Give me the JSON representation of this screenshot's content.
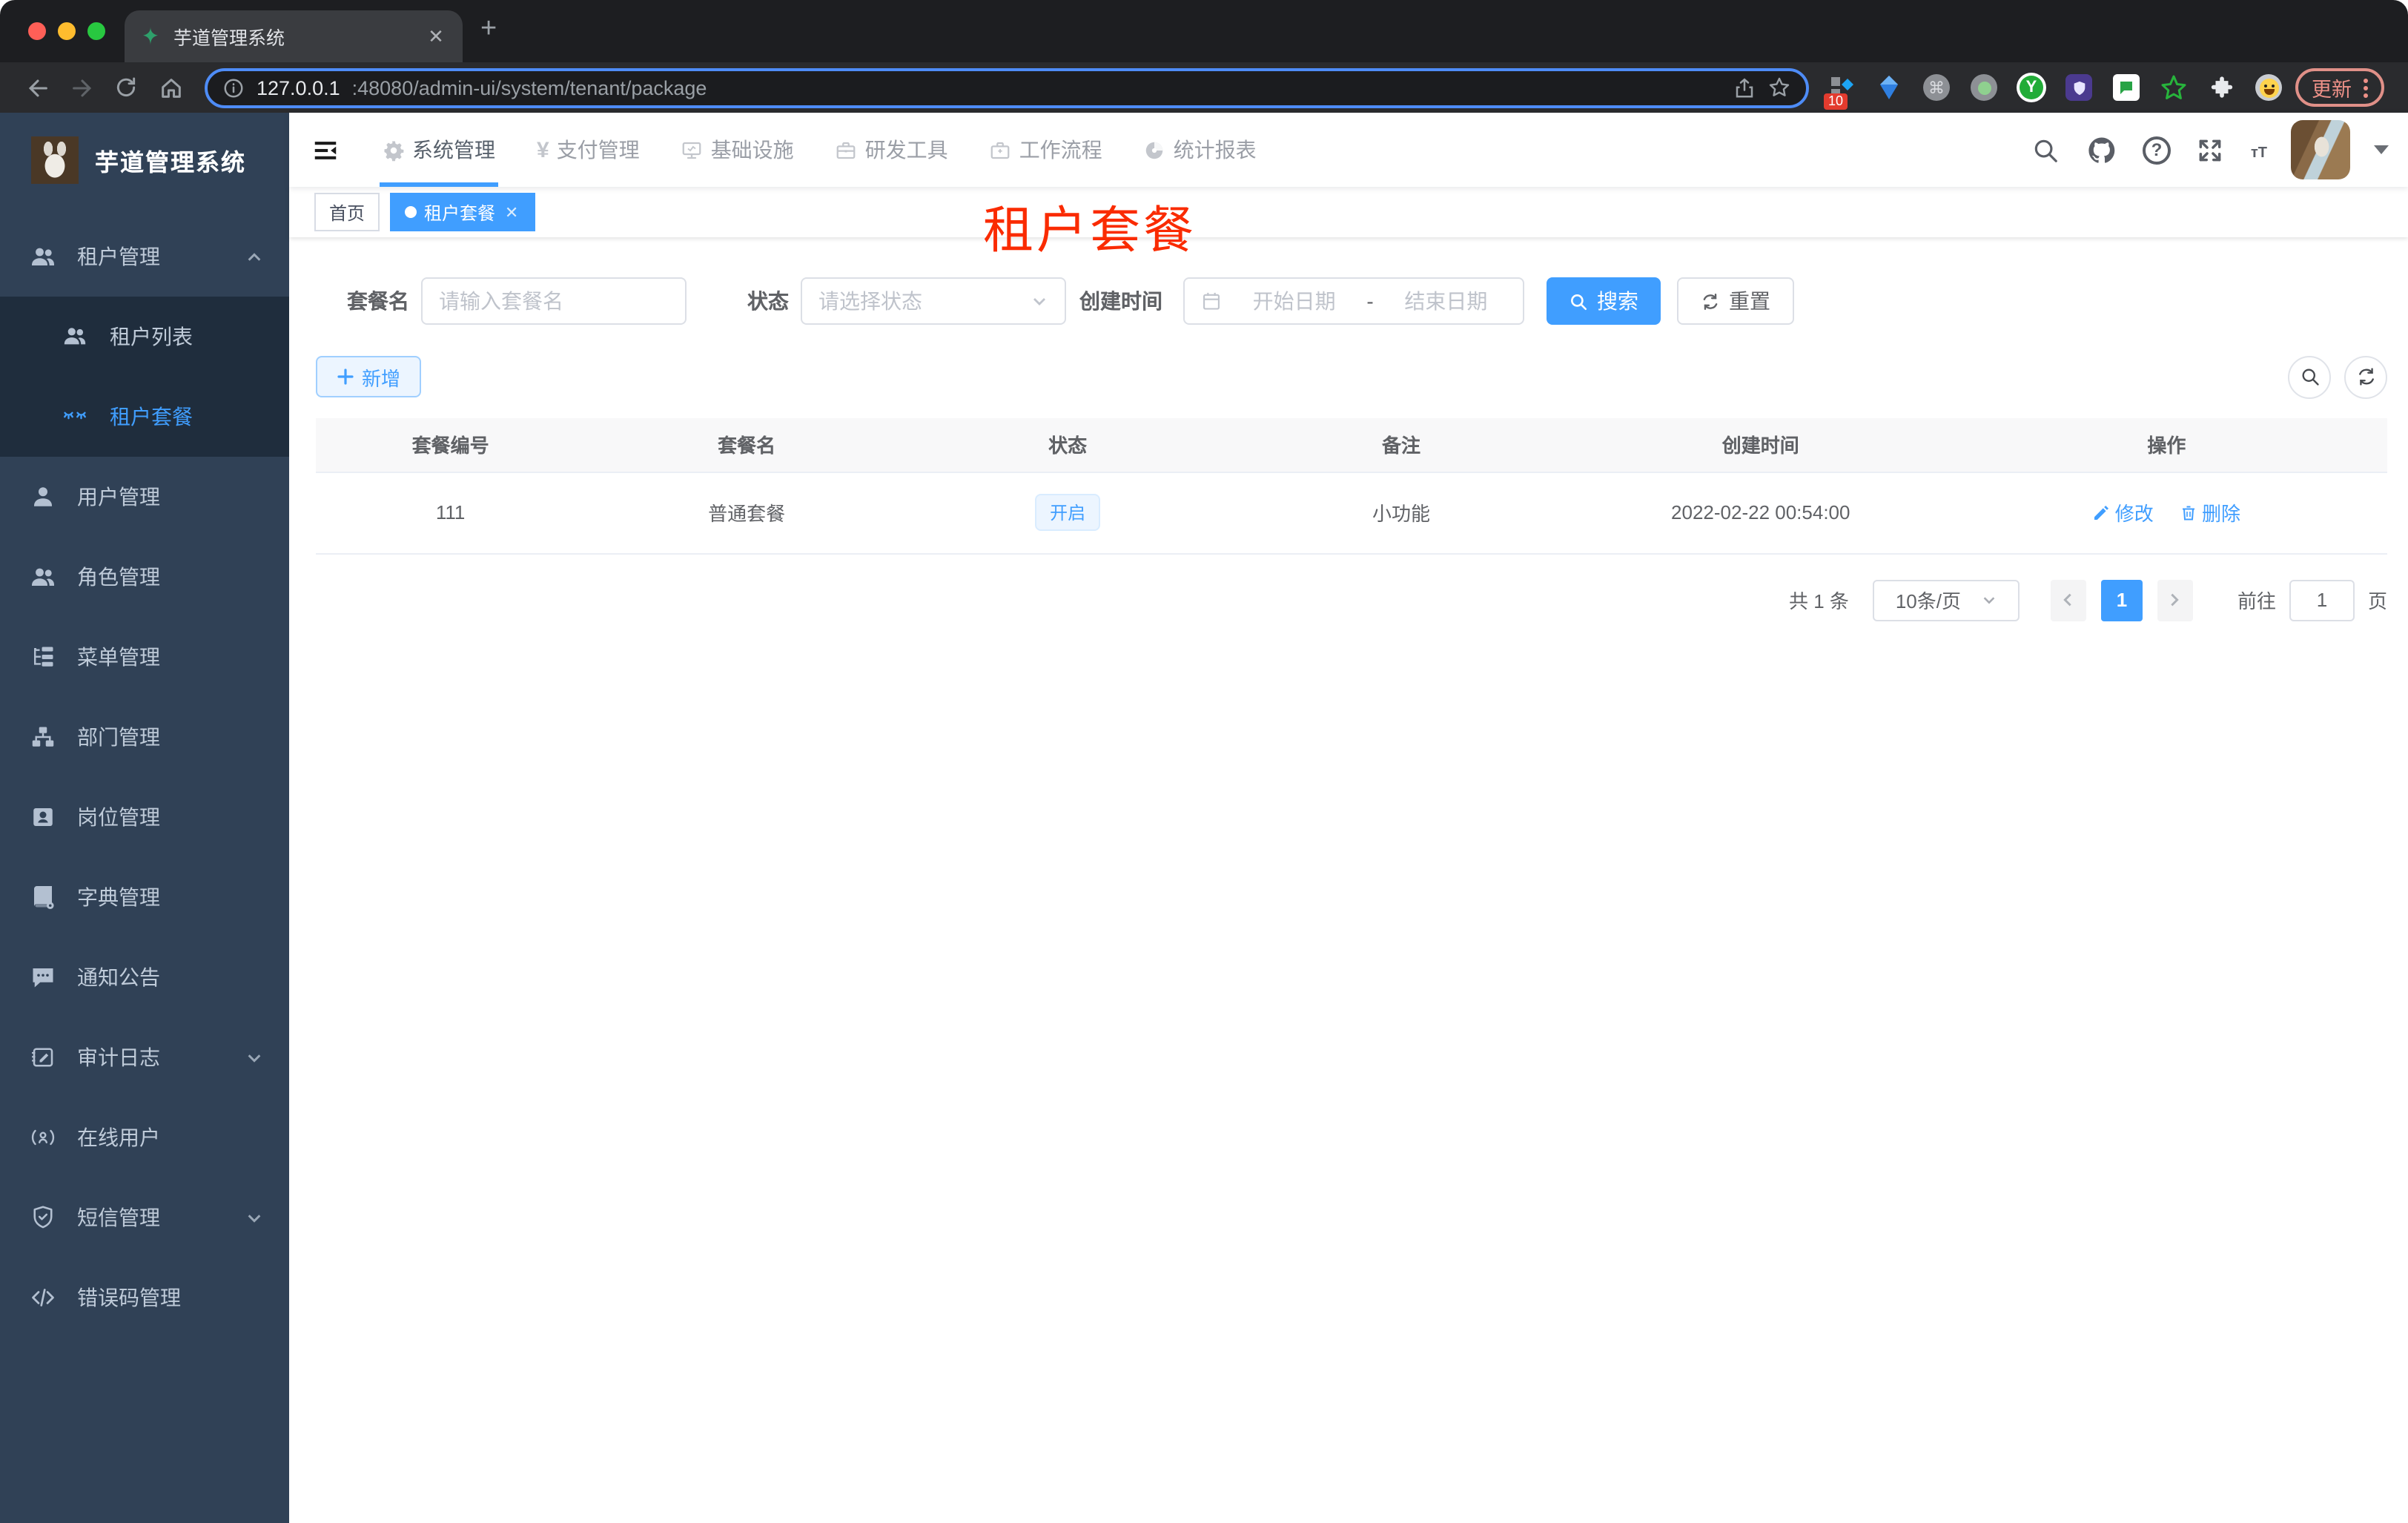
{
  "browser": {
    "tab_title": "芋道管理系统",
    "favicon": "sprout-icon",
    "url_host": "127.0.0.1",
    "url_path": ":48080/admin-ui/system/tenant/package",
    "extension_badge": "10",
    "update_label": "更新"
  },
  "sidebar": {
    "logo_title": "芋道管理系统",
    "menu": [
      {
        "label": "租户管理",
        "icon": "users-icon",
        "arrow": "up"
      },
      {
        "label": "租户列表",
        "icon": "users-icon"
      },
      {
        "label": "租户套餐",
        "icon": "package-lashes-icon",
        "active": true
      },
      {
        "label": "用户管理",
        "icon": "user-icon"
      },
      {
        "label": "角色管理",
        "icon": "users-icon"
      },
      {
        "label": "菜单管理",
        "icon": "tree-icon"
      },
      {
        "label": "部门管理",
        "icon": "org-icon"
      },
      {
        "label": "岗位管理",
        "icon": "badge-icon"
      },
      {
        "label": "字典管理",
        "icon": "book-icon"
      },
      {
        "label": "通知公告",
        "icon": "message-icon"
      },
      {
        "label": "审计日志",
        "icon": "edit-square-icon",
        "arrow": "down"
      },
      {
        "label": "在线用户",
        "icon": "broadcast-icon"
      },
      {
        "label": "短信管理",
        "icon": "shield-icon",
        "arrow": "down"
      },
      {
        "label": "错误码管理",
        "icon": "code-icon"
      }
    ]
  },
  "topnav": {
    "items": [
      {
        "label": "系统管理",
        "icon": "gear-icon",
        "active": true
      },
      {
        "label": "支付管理",
        "icon": "yen-icon"
      },
      {
        "label": "基础设施",
        "icon": "monitor-icon"
      },
      {
        "label": "研发工具",
        "icon": "toolbox-icon"
      },
      {
        "label": "工作流程",
        "icon": "briefcase-icon"
      },
      {
        "label": "统计报表",
        "icon": "dashboard-icon"
      }
    ],
    "right_icons": [
      "search-icon",
      "github-icon",
      "help-icon",
      "fullscreen-icon",
      "font-size-icon"
    ],
    "font_size_glyph": "тT"
  },
  "tags": [
    {
      "label": "首页"
    },
    {
      "label": "租户套餐",
      "active": true
    }
  ],
  "page": {
    "red_title": "租户套餐",
    "filters": {
      "name_label": "套餐名",
      "name_placeholder": "请输入套餐名",
      "status_label": "状态",
      "status_placeholder": "请选择状态",
      "date_label": "创建时间",
      "date_start_placeholder": "开始日期",
      "date_separator": "-",
      "date_end_placeholder": "结束日期",
      "search_label": "搜索",
      "reset_label": "重置"
    },
    "add_label": "新增",
    "table": {
      "columns": [
        "套餐编号",
        "套餐名",
        "状态",
        "备注",
        "创建时间",
        "操作"
      ],
      "rows": [
        {
          "id": "111",
          "name": "普通套餐",
          "status": "开启",
          "remark": "小功能",
          "created_at": "2022-02-22 00:54:00",
          "edit_label": "修改",
          "delete_label": "删除"
        }
      ]
    },
    "pagination": {
      "total": "共 1 条",
      "page_size": "10条/页",
      "current_page": "1",
      "goto_label": "前往",
      "goto_value": "1",
      "page_suffix": "页"
    }
  },
  "colors": {
    "primary": "#409eff",
    "red_title": "#fa2b00",
    "sidebar_bg": "#304156",
    "submenu_bg": "#1f2d3d",
    "status_tag_bg": "#ecf5ff"
  }
}
